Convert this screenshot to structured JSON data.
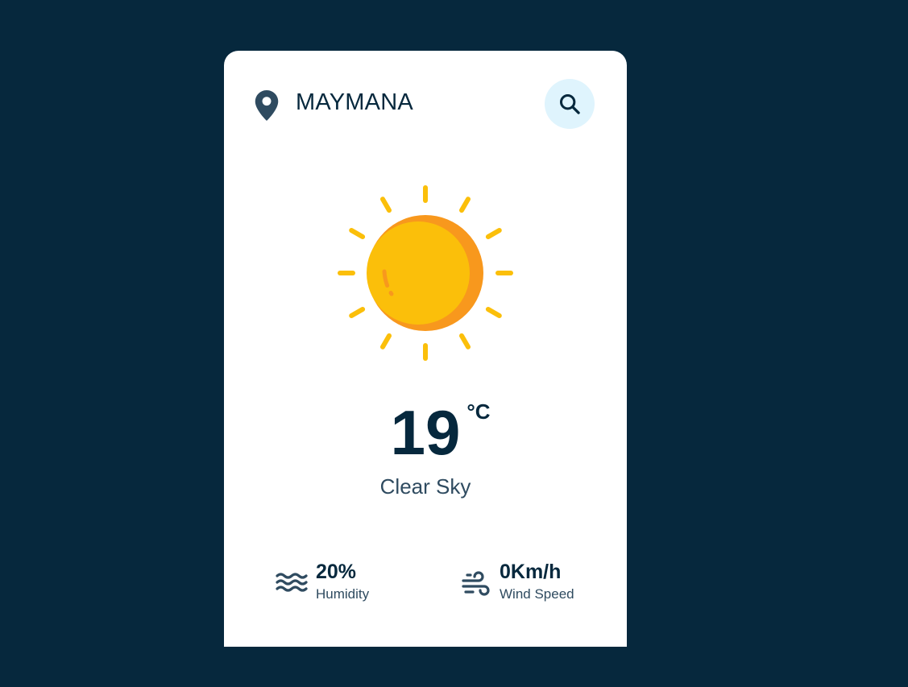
{
  "location": {
    "city": "MAYMANA",
    "icon": "map-pin-icon"
  },
  "search": {
    "icon": "search-icon"
  },
  "weather": {
    "icon": "sun-icon",
    "temperature": "19",
    "unit": "°C",
    "description": "Clear Sky"
  },
  "stats": {
    "humidity": {
      "value": "20%",
      "label": "Humidity",
      "icon": "waves-icon"
    },
    "wind": {
      "value": "0Km/h",
      "label": "Wind Speed",
      "icon": "wind-icon"
    }
  },
  "colors": {
    "background": "#06283d",
    "card": "#ffffff",
    "search_button": "#dff4fd",
    "sun": "#fbbf0a",
    "sun_shade": "#f8981d",
    "text": "#06283d"
  }
}
